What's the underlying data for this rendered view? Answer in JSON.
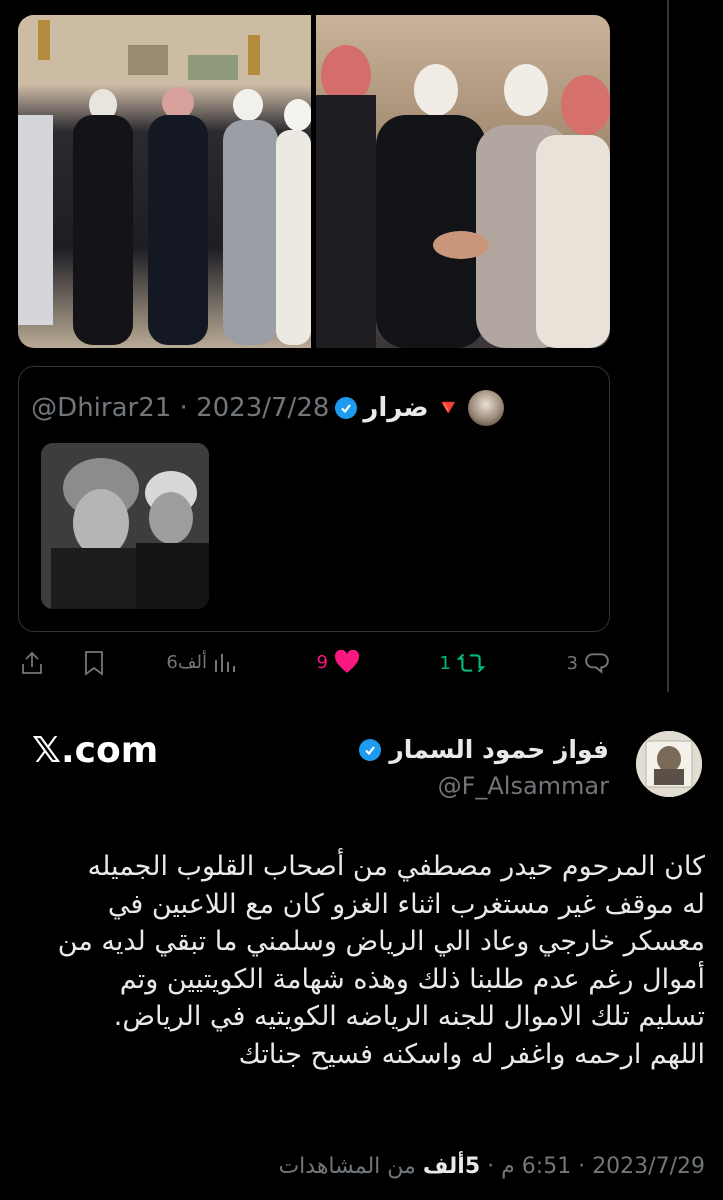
{
  "quoted_tweet": {
    "display_name": "ضرار",
    "emoji": "🔻",
    "handle_date": "@Dhirar21 · 2023/7/28",
    "avatar_icon": "avatar"
  },
  "actions": {
    "replies": "3",
    "retweets": "1",
    "likes": "9",
    "views": "6ألف"
  },
  "author": {
    "name": "فواز حمود السمار",
    "handle": "@F_Alsammar"
  },
  "brand": "𝕏.com",
  "tweet_text": "كان المرحوم حيدر مصطفي من أصحاب القلوب الجميله\nله موقف غير مستغرب اثناء الغزو كان مع اللاعبين في\nمعسكر خارجي وعاد الي الرياض وسلمني ما تبقي لديه من\nأموال رغم عدم طلبنا ذلك وهذه شهامة الكويتيين وتم\nتسليم تلك الاموال للجنه الرياضه الكويتيه في الرياض.\nاللهم ارحمه واغفر له واسكنه فسيح جناتك",
  "meta": {
    "date": "2023/7/29",
    "time": "6:51 م",
    "views_count": "5ألف",
    "views_label": "من المشاهدات"
  },
  "colors": {
    "like": "#f91880",
    "retweet": "#00ba7c",
    "verified": "#1d9bf0",
    "muted": "#71767b"
  }
}
